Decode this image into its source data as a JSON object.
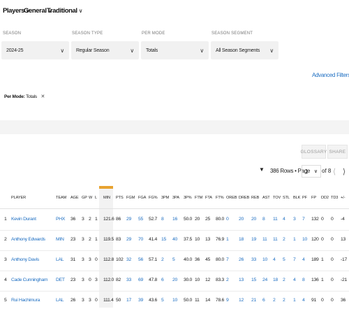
{
  "nav": {
    "players": "Players",
    "general": "General",
    "traditional": "Traditional"
  },
  "filters": {
    "season": {
      "label": "SEASON",
      "value": "2024-25"
    },
    "season_type": {
      "label": "SEASON TYPE",
      "value": "Regular Season"
    },
    "per_mode": {
      "label": "PER MODE",
      "value": "Totals"
    },
    "season_segment": {
      "label": "SEASON SEGMENT",
      "value": "All Season Segments"
    }
  },
  "advanced_filters": "Advanced Filters",
  "per_mode_chip": {
    "label": "Per Mode:",
    "value": "Totals"
  },
  "buttons": {
    "glossary": "GLOSSARY",
    "share": "SHARE"
  },
  "pagination": {
    "rows_text": "386 Rows • Page",
    "page": "1",
    "of_text": "of 8"
  },
  "table": {
    "columns": [
      "PLAYER",
      "TEAM",
      "AGE",
      "GP",
      "W",
      "L",
      "MIN",
      "PTS",
      "FGM",
      "FGA",
      "FG%",
      "3PM",
      "3PA",
      "3P%",
      "FTM",
      "FTA",
      "FT%",
      "OREB",
      "DREB",
      "REB",
      "AST",
      "TOV",
      "STL",
      "BLK",
      "PF",
      "FP",
      "DD2",
      "TD3",
      "+/-"
    ],
    "sorted_column": "MIN",
    "rows": [
      {
        "rank": "1",
        "player": "Kevin Durant",
        "team": "PHX",
        "age": "36",
        "gp": "3",
        "w": "2",
        "l": "1",
        "min": "121.6",
        "pts": "86",
        "fgm": "29",
        "fga": "55",
        "fg_pct": "52.7",
        "tpm": "8",
        "tpa": "16",
        "tp_pct": "50.0",
        "ftm": "20",
        "fta": "25",
        "ft_pct": "80.0",
        "oreb": "0",
        "dreb": "20",
        "reb": "20",
        "ast": "8",
        "tov": "11",
        "stl": "4",
        "blk": "3",
        "pf": "7",
        "fp": "132",
        "dd2": "0",
        "td3": "0",
        "pm": "-4"
      },
      {
        "rank": "2",
        "player": "Anthony Edwards",
        "team": "MIN",
        "age": "23",
        "gp": "3",
        "w": "2",
        "l": "1",
        "min": "119.5",
        "pts": "83",
        "fgm": "29",
        "fga": "70",
        "fg_pct": "41.4",
        "tpm": "15",
        "tpa": "40",
        "tp_pct": "37.5",
        "ftm": "10",
        "fta": "13",
        "ft_pct": "76.9",
        "oreb": "1",
        "dreb": "18",
        "reb": "19",
        "ast": "11",
        "tov": "11",
        "stl": "2",
        "blk": "1",
        "pf": "10",
        "fp": "120",
        "dd2": "0",
        "td3": "0",
        "pm": "13"
      },
      {
        "rank": "3",
        "player": "Anthony Davis",
        "team": "LAL",
        "age": "31",
        "gp": "3",
        "w": "3",
        "l": "0",
        "min": "112.8",
        "pts": "102",
        "fgm": "32",
        "fga": "56",
        "fg_pct": "57.1",
        "tpm": "2",
        "tpa": "5",
        "tp_pct": "40.0",
        "ftm": "36",
        "fta": "45",
        "ft_pct": "80.0",
        "oreb": "7",
        "dreb": "26",
        "reb": "33",
        "ast": "10",
        "tov": "4",
        "stl": "5",
        "blk": "7",
        "pf": "4",
        "fp": "189",
        "dd2": "1",
        "td3": "0",
        "pm": "-17"
      },
      {
        "rank": "4",
        "player": "Cade Cunningham",
        "team": "DET",
        "age": "23",
        "gp": "3",
        "w": "0",
        "l": "3",
        "min": "112.0",
        "pts": "82",
        "fgm": "33",
        "fga": "69",
        "fg_pct": "47.8",
        "tpm": "6",
        "tpa": "20",
        "tp_pct": "30.0",
        "ftm": "10",
        "fta": "12",
        "ft_pct": "83.3",
        "oreb": "2",
        "dreb": "13",
        "reb": "15",
        "ast": "24",
        "tov": "18",
        "stl": "2",
        "blk": "4",
        "pf": "8",
        "fp": "136",
        "dd2": "1",
        "td3": "0",
        "pm": "-21"
      },
      {
        "rank": "5",
        "player": "Rui Hachimura",
        "team": "LAL",
        "age": "26",
        "gp": "3",
        "w": "3",
        "l": "0",
        "min": "111.4",
        "pts": "50",
        "fgm": "17",
        "fga": "39",
        "fg_pct": "43.6",
        "tpm": "5",
        "tpa": "10",
        "tp_pct": "50.0",
        "ftm": "11",
        "fta": "14",
        "ft_pct": "78.6",
        "oreb": "9",
        "dreb": "12",
        "reb": "21",
        "ast": "6",
        "tov": "2",
        "stl": "2",
        "blk": "1",
        "pf": "4",
        "fp": "91",
        "dd2": "0",
        "td3": "0",
        "pm": "36"
      }
    ]
  }
}
